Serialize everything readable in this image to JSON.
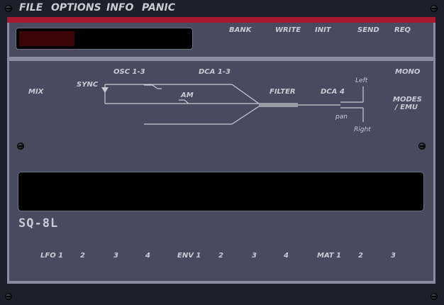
{
  "menu": [
    "FILE",
    "OPTIONS",
    "INFO",
    "PANIC"
  ],
  "top_buttons": [
    "BANK",
    "WRITE",
    "INIT",
    "SEND",
    "REQ"
  ],
  "diagram": {
    "mix": "MIX",
    "sync": "SYNC",
    "osc": "OSC 1-3",
    "dca": "DCA 1-3",
    "am": "AM",
    "filter": "FILTER",
    "dca4": "DCA 4",
    "left": "Left",
    "pan": "pan",
    "right": "Right",
    "mono": "MONO",
    "modes_line1": "MODES",
    "modes_line2": "/ EMU"
  },
  "logo": "SQ-8L",
  "mod_groups": {
    "lfo": [
      "LFO 1",
      "2",
      "3",
      "4"
    ],
    "env": [
      "ENV 1",
      "2",
      "3",
      "4"
    ],
    "mat": [
      "MAT 1",
      "2",
      "3"
    ]
  },
  "colors": {
    "accent_red": "#a8182f",
    "panel": "#4a4a5e",
    "label": "#c9cad3"
  }
}
